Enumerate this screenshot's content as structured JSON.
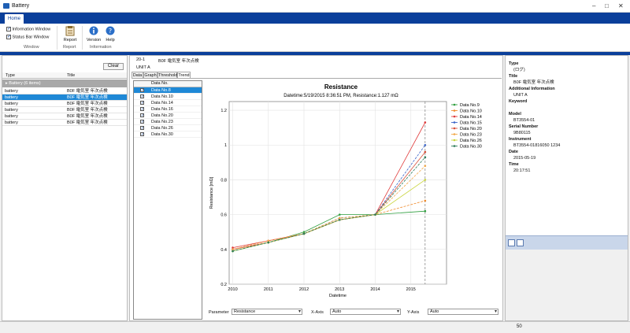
{
  "app": {
    "title": "Battery"
  },
  "ribbon": {
    "tab_home": "Home",
    "window_group": {
      "info_window": "Information Window",
      "status_bar_window": "Status Bar Window",
      "label": "Window"
    },
    "report_group": {
      "report_btn": "Report",
      "label": "Report"
    },
    "info_group": {
      "version_btn": "Version",
      "help_btn": "Help",
      "label": "Information"
    }
  },
  "left_panel": {
    "clear_btn": "Clear",
    "col_type": "Type",
    "col_title": "Title",
    "group_label": "Battery (6 items)",
    "rows": [
      {
        "type": "battery",
        "title": "B0F 電気室 年次点検"
      },
      {
        "type": "battery",
        "title": "B0F 電気室 年次点検",
        "selected": true
      },
      {
        "type": "battery",
        "title": "B0F 電気室 年次点検"
      },
      {
        "type": "battery",
        "title": "B0F 電気室 年次点検"
      },
      {
        "type": "battery",
        "title": "B0F 電気室 年次点検"
      },
      {
        "type": "battery",
        "title": "B0F 電気室 年次点検"
      }
    ]
  },
  "center": {
    "header_num": "20-1",
    "header_title": "B0F 電気室 年次点検",
    "unit": "UNIT A",
    "tabs": [
      "Data",
      "Graph",
      "Threshold",
      "Trend"
    ],
    "list_header": "Data No.",
    "items": [
      {
        "label": "Data No.8",
        "selected": true
      },
      {
        "label": "Data No.10"
      },
      {
        "label": "Data No.14"
      },
      {
        "label": "Data No.16"
      },
      {
        "label": "Data No.20"
      },
      {
        "label": "Data No.23"
      },
      {
        "label": "Data No.26"
      },
      {
        "label": "Data No.30"
      }
    ],
    "controls": {
      "parameter_label": "Parameter",
      "parameter_value": "Resistance",
      "xaxis_label": "X-Axis",
      "xaxis_value": "Auto",
      "yaxis_label": "Y-Axis",
      "yaxis_value": "Auto"
    }
  },
  "chart_data": {
    "type": "line",
    "title": "Resistance",
    "subtitle": "Datetime:5/19/2015 8:36:51 PM, Resistance:1.127 mΩ",
    "xlabel": "Datetime",
    "ylabel": "Resistance [mΩ]",
    "x": [
      2010.0,
      2011.0,
      2012.0,
      2013.0,
      2014.0,
      2015.4
    ],
    "xticks": [
      "2010",
      "2011",
      "2012",
      "2013",
      "2014",
      "2015"
    ],
    "xlim": [
      2009.9,
      2016.0
    ],
    "ylim": [
      0.2,
      1.25
    ],
    "yticks": [
      "0.2",
      "0.4",
      "0.6",
      "0.8",
      "1",
      "1.2"
    ],
    "grid": true,
    "legend": "right",
    "cursor_x": 2015.4,
    "series": [
      {
        "name": "Data No.9",
        "color": "#2e9e3e",
        "values": [
          0.39,
          0.44,
          0.5,
          0.6,
          0.6,
          0.62
        ]
      },
      {
        "name": "Data No.10",
        "color": "#f08c2e",
        "values": [
          0.4,
          0.45,
          0.49,
          0.58,
          0.6,
          0.68
        ]
      },
      {
        "name": "Data No.14",
        "color": "#e03a3a",
        "values": [
          0.41,
          0.45,
          0.49,
          0.57,
          0.6,
          1.13
        ]
      },
      {
        "name": "Data No.15",
        "color": "#3a64c8",
        "values": [
          0.4,
          0.44,
          0.49,
          0.58,
          0.6,
          1.0
        ]
      },
      {
        "name": "Data No.20",
        "color": "#d8503a",
        "values": [
          0.4,
          0.44,
          0.49,
          0.57,
          0.6,
          0.96
        ]
      },
      {
        "name": "Data No.23",
        "color": "#f2a94a",
        "values": [
          0.4,
          0.45,
          0.49,
          0.58,
          0.6,
          0.88
        ]
      },
      {
        "name": "Data No.26",
        "color": "#c8d43a",
        "values": [
          0.39,
          0.44,
          0.49,
          0.57,
          0.6,
          0.8
        ]
      },
      {
        "name": "Data No.30",
        "color": "#2e7d5a",
        "values": [
          0.39,
          0.44,
          0.49,
          0.57,
          0.6,
          0.93
        ]
      }
    ]
  },
  "right_panel": {
    "type_label": "Type",
    "type_value": "(ログ)",
    "title_label": "Title",
    "title_value": "B0F 電気室 年次点検",
    "addl_label": "Additional Information",
    "addl_value": "UNIT A",
    "keyword_label": "Keyword",
    "model_label": "Model",
    "model_value": "BT3554-01",
    "serial_label": "Serial Number",
    "serial_value": "9B80115",
    "instrument_label": "Instrument",
    "instrument_value": "BT3554-01816050 1234",
    "date_label": "Date",
    "date_value": "2015-05-19",
    "time_label": "Time",
    "time_value": "20:17:51"
  },
  "status": {
    "value": "50"
  }
}
